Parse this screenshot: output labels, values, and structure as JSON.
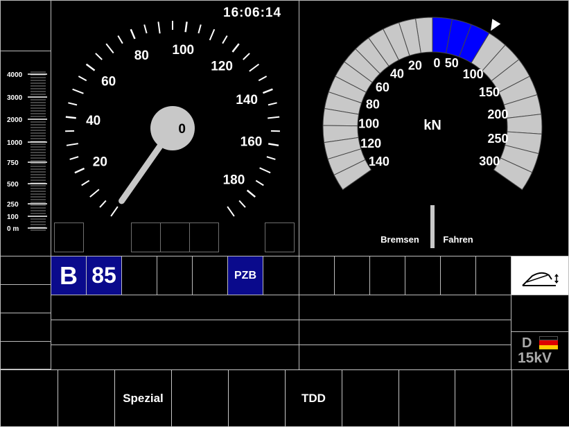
{
  "clock": {
    "time": "16:06:14"
  },
  "distance_scale": {
    "labels": [
      "4000",
      "3000",
      "2000",
      "1000",
      "750",
      "500",
      "250",
      "100",
      "0 m"
    ]
  },
  "speedometer": {
    "tick_labels": [
      "20",
      "40",
      "60",
      "80",
      "100",
      "120",
      "140",
      "160",
      "180"
    ],
    "current_speed": "0",
    "needle_color": "#c8c8c8"
  },
  "force_gauge": {
    "unit": "kN",
    "brake_labels": [
      "0",
      "20",
      "40",
      "60",
      "80",
      "100",
      "120",
      "140"
    ],
    "drive_labels": [
      "50",
      "100",
      "150",
      "200",
      "250",
      "300"
    ],
    "brake_label": "Bremsen",
    "drive_label": "Fahren",
    "active_drive_fraction": 0.28,
    "active_color": "#0000ff",
    "inactive_color": "#c8c8c8"
  },
  "status_row": {
    "mode_letter": "B",
    "train_type": "85",
    "pzb": "PZB"
  },
  "network": {
    "country": "D",
    "voltage": "15kV"
  },
  "softkeys": [
    "",
    "",
    "Spezial",
    "",
    "",
    "TDD",
    "",
    "",
    "",
    ""
  ]
}
